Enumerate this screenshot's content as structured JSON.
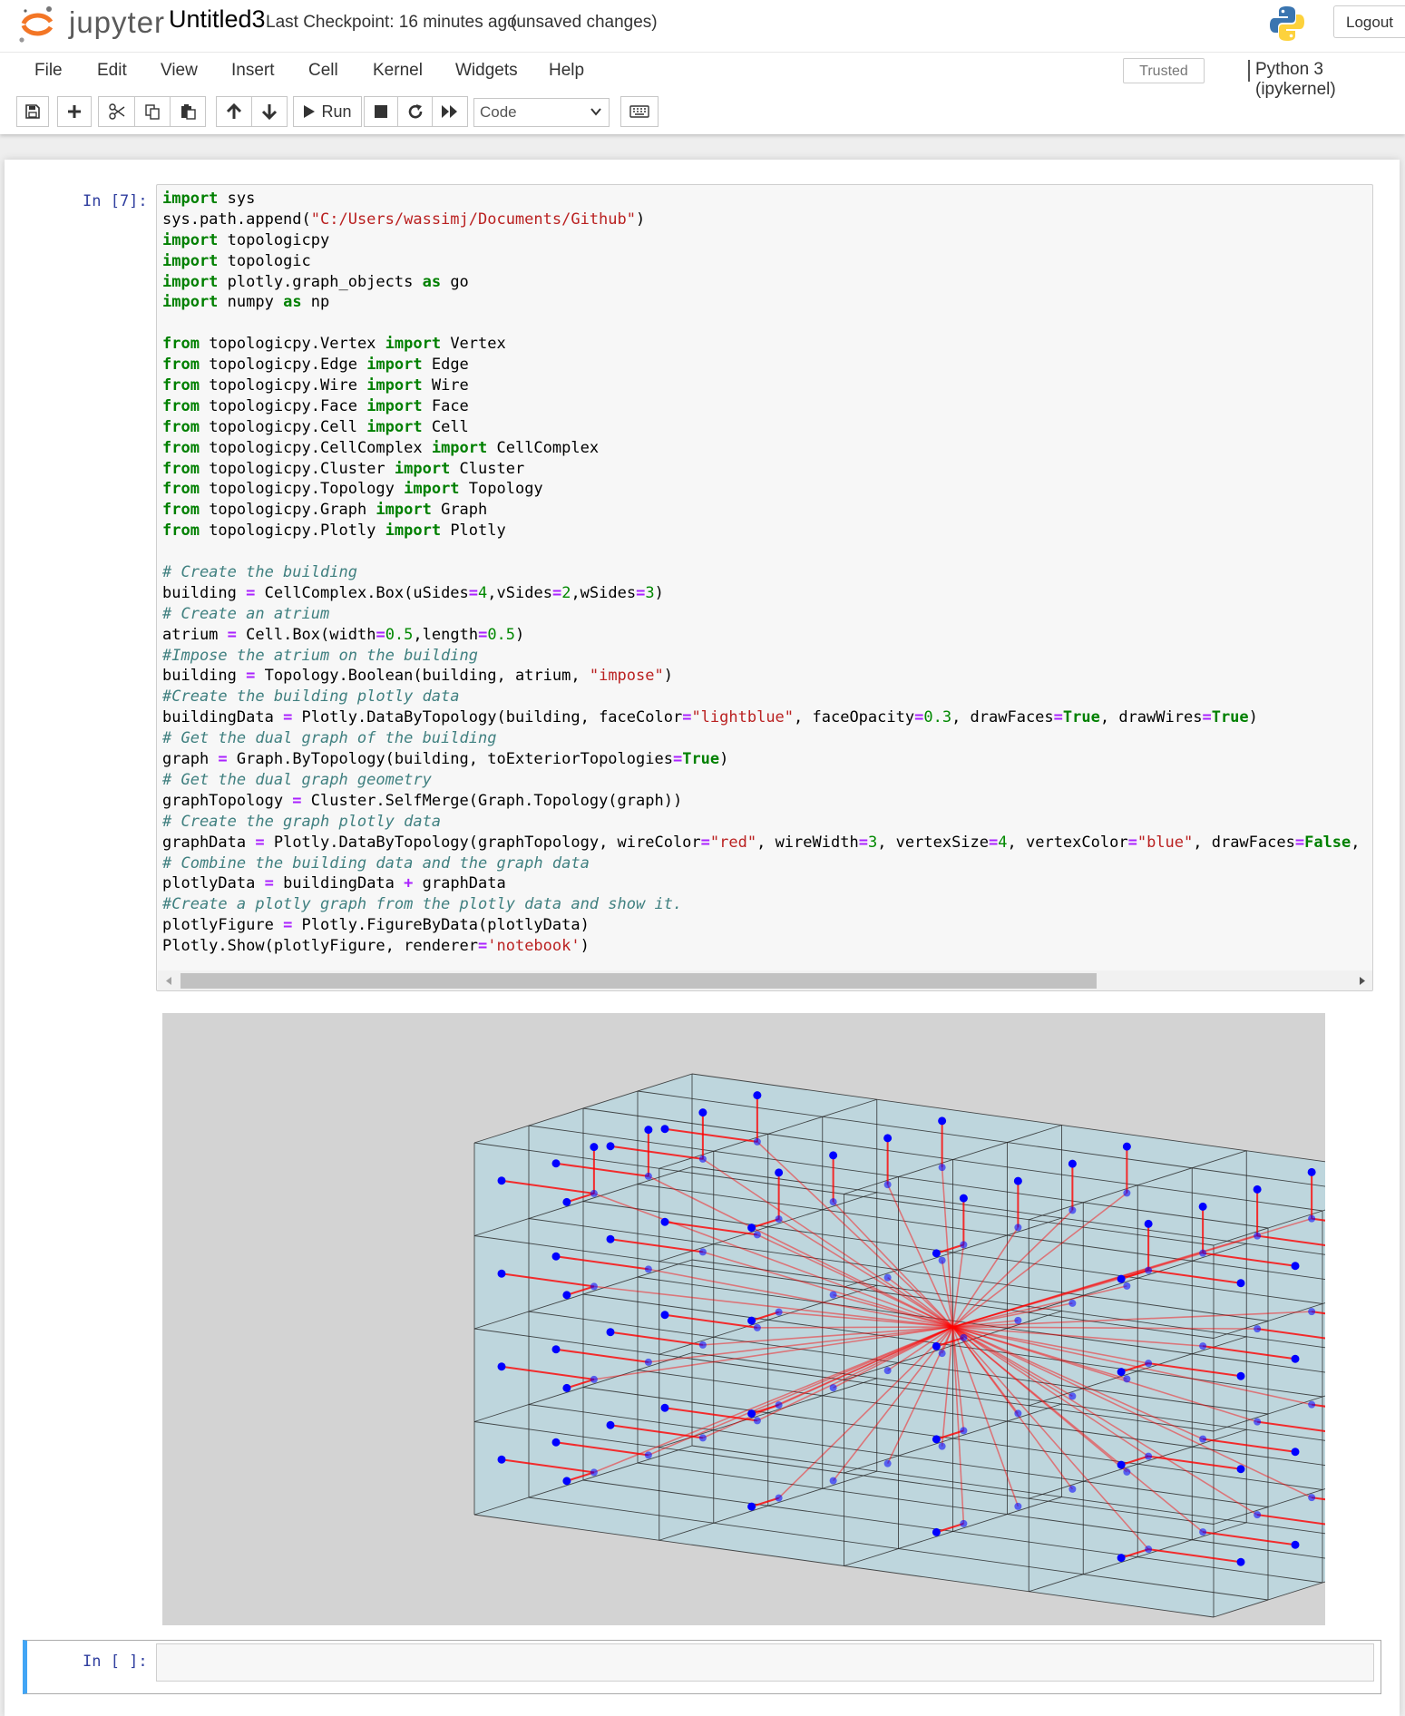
{
  "header": {
    "logo_text": "jupyter",
    "notebook_name": "Untitled3",
    "checkpoint": "Last Checkpoint: 16 minutes ago",
    "unsaved": "(unsaved changes)",
    "logout": "Logout"
  },
  "menu": {
    "items": [
      "File",
      "Edit",
      "View",
      "Insert",
      "Cell",
      "Kernel",
      "Widgets",
      "Help"
    ],
    "trusted": "Trusted",
    "kernel": "Python 3 (ipykernel)"
  },
  "toolbar": {
    "run_label": "Run",
    "cell_type": "Code"
  },
  "cells": {
    "code_prompt": "In [7]:",
    "empty_prompt": "In [ ]:"
  },
  "colors": {
    "prompt": "#303f9f",
    "selected_cell": "#42a5f5",
    "face": "#add8e6",
    "edge": "#ff0000",
    "vertex": "#0000ff"
  }
}
